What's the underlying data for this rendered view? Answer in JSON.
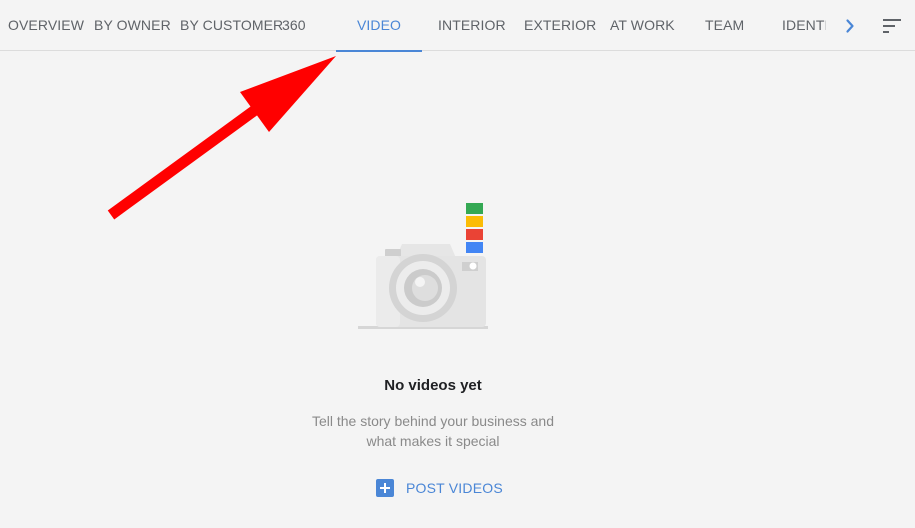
{
  "tabs": {
    "items": [
      {
        "label": "OVERVIEW"
      },
      {
        "label": "BY OWNER"
      },
      {
        "label": "BY CUSTOMER"
      },
      {
        "label": "360"
      },
      {
        "label": "VIDEO"
      },
      {
        "label": "INTERIOR"
      },
      {
        "label": "EXTERIOR"
      },
      {
        "label": "AT WORK"
      },
      {
        "label": "TEAM"
      },
      {
        "label": "IDENTITY"
      }
    ],
    "active": "VIDEO"
  },
  "empty_state": {
    "title": "No videos yet",
    "description_line1": "Tell the story behind your business and",
    "description_line2": "what makes it special"
  },
  "actions": {
    "post_videos_label": "POST VIDEOS"
  },
  "colors": {
    "accent": "#4a86d6",
    "arrow": "#ff0000",
    "stripe_green": "#34a853",
    "stripe_yellow": "#fbbc05",
    "stripe_red": "#ea4335",
    "stripe_blue": "#4285f4"
  },
  "icons": {
    "scroll": "chevron-right-icon",
    "menu": "sort-icon",
    "post": "plus-box-icon",
    "illustration": "camera-icon"
  }
}
